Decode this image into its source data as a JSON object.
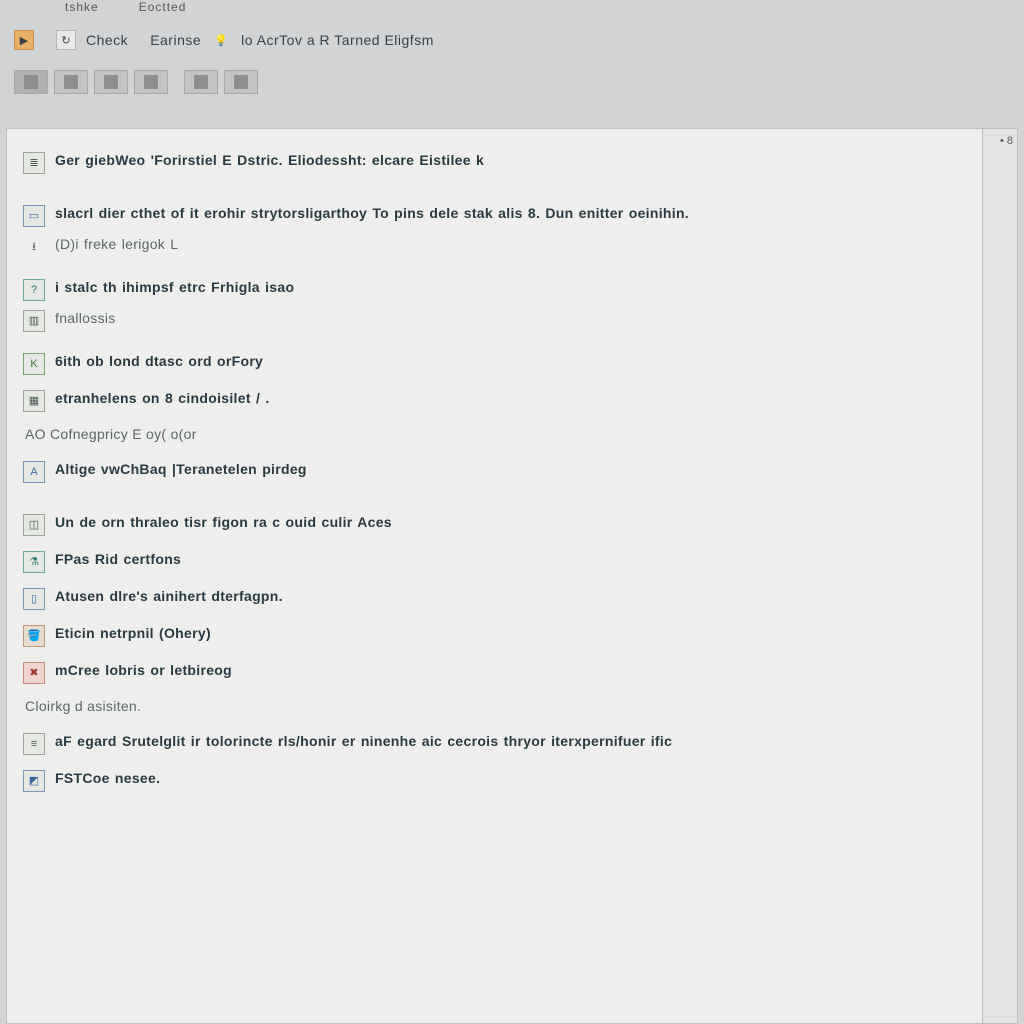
{
  "menubar": {
    "item1": "tshke",
    "item2": "Eoctted"
  },
  "toolbar": {
    "label_check": "Check",
    "label_earise": "Earinse",
    "label_rest": "lo  AcrTov a R Tarned Eligfsm"
  },
  "side": {
    "marker": "• 8"
  },
  "lines": {
    "l1": "Ger giebWeo 'Forirstiel  E  Dstric.  Eliodessht:  elcare Eistilee k",
    "l2": "slacrl dier cthet of it erohir strytorsligarthoy To pins dele stak alis 8. Dun enitter oeinihin.",
    "l2b": "(D)i freke lerigok L",
    "l3": "i stalc th ihimpsf etrc Frhigla  isao",
    "l3b": "fnallossis",
    "l4": "6ith ob lond dtasc ord orFory",
    "l5": "etranhelens on 8  cindoisilet / .",
    "l5b": "AO  Cofnegpricy  E   oy(   o(or",
    "l6": "Altige vwChBaq  |Teranetelen pirdeg",
    "l7": "Un de orn thraleo tisr figon ra  c ouid culir Aces",
    "l8": "FPas Rid certfons",
    "l9": "Atusen dlre's ainihert dterfagpn.",
    "l10": "Eticin netrpnil (Ohery)",
    "l11": "mCree lobris or  letbireog",
    "l11b": "Cloirkg d asisiten.",
    "l12": "aF  egard Srutelglit ir tolorincte rls/honir er ninenhe aic cecrois thryor iterxpernifuer ific",
    "l13": "FSTCoe nesee."
  }
}
